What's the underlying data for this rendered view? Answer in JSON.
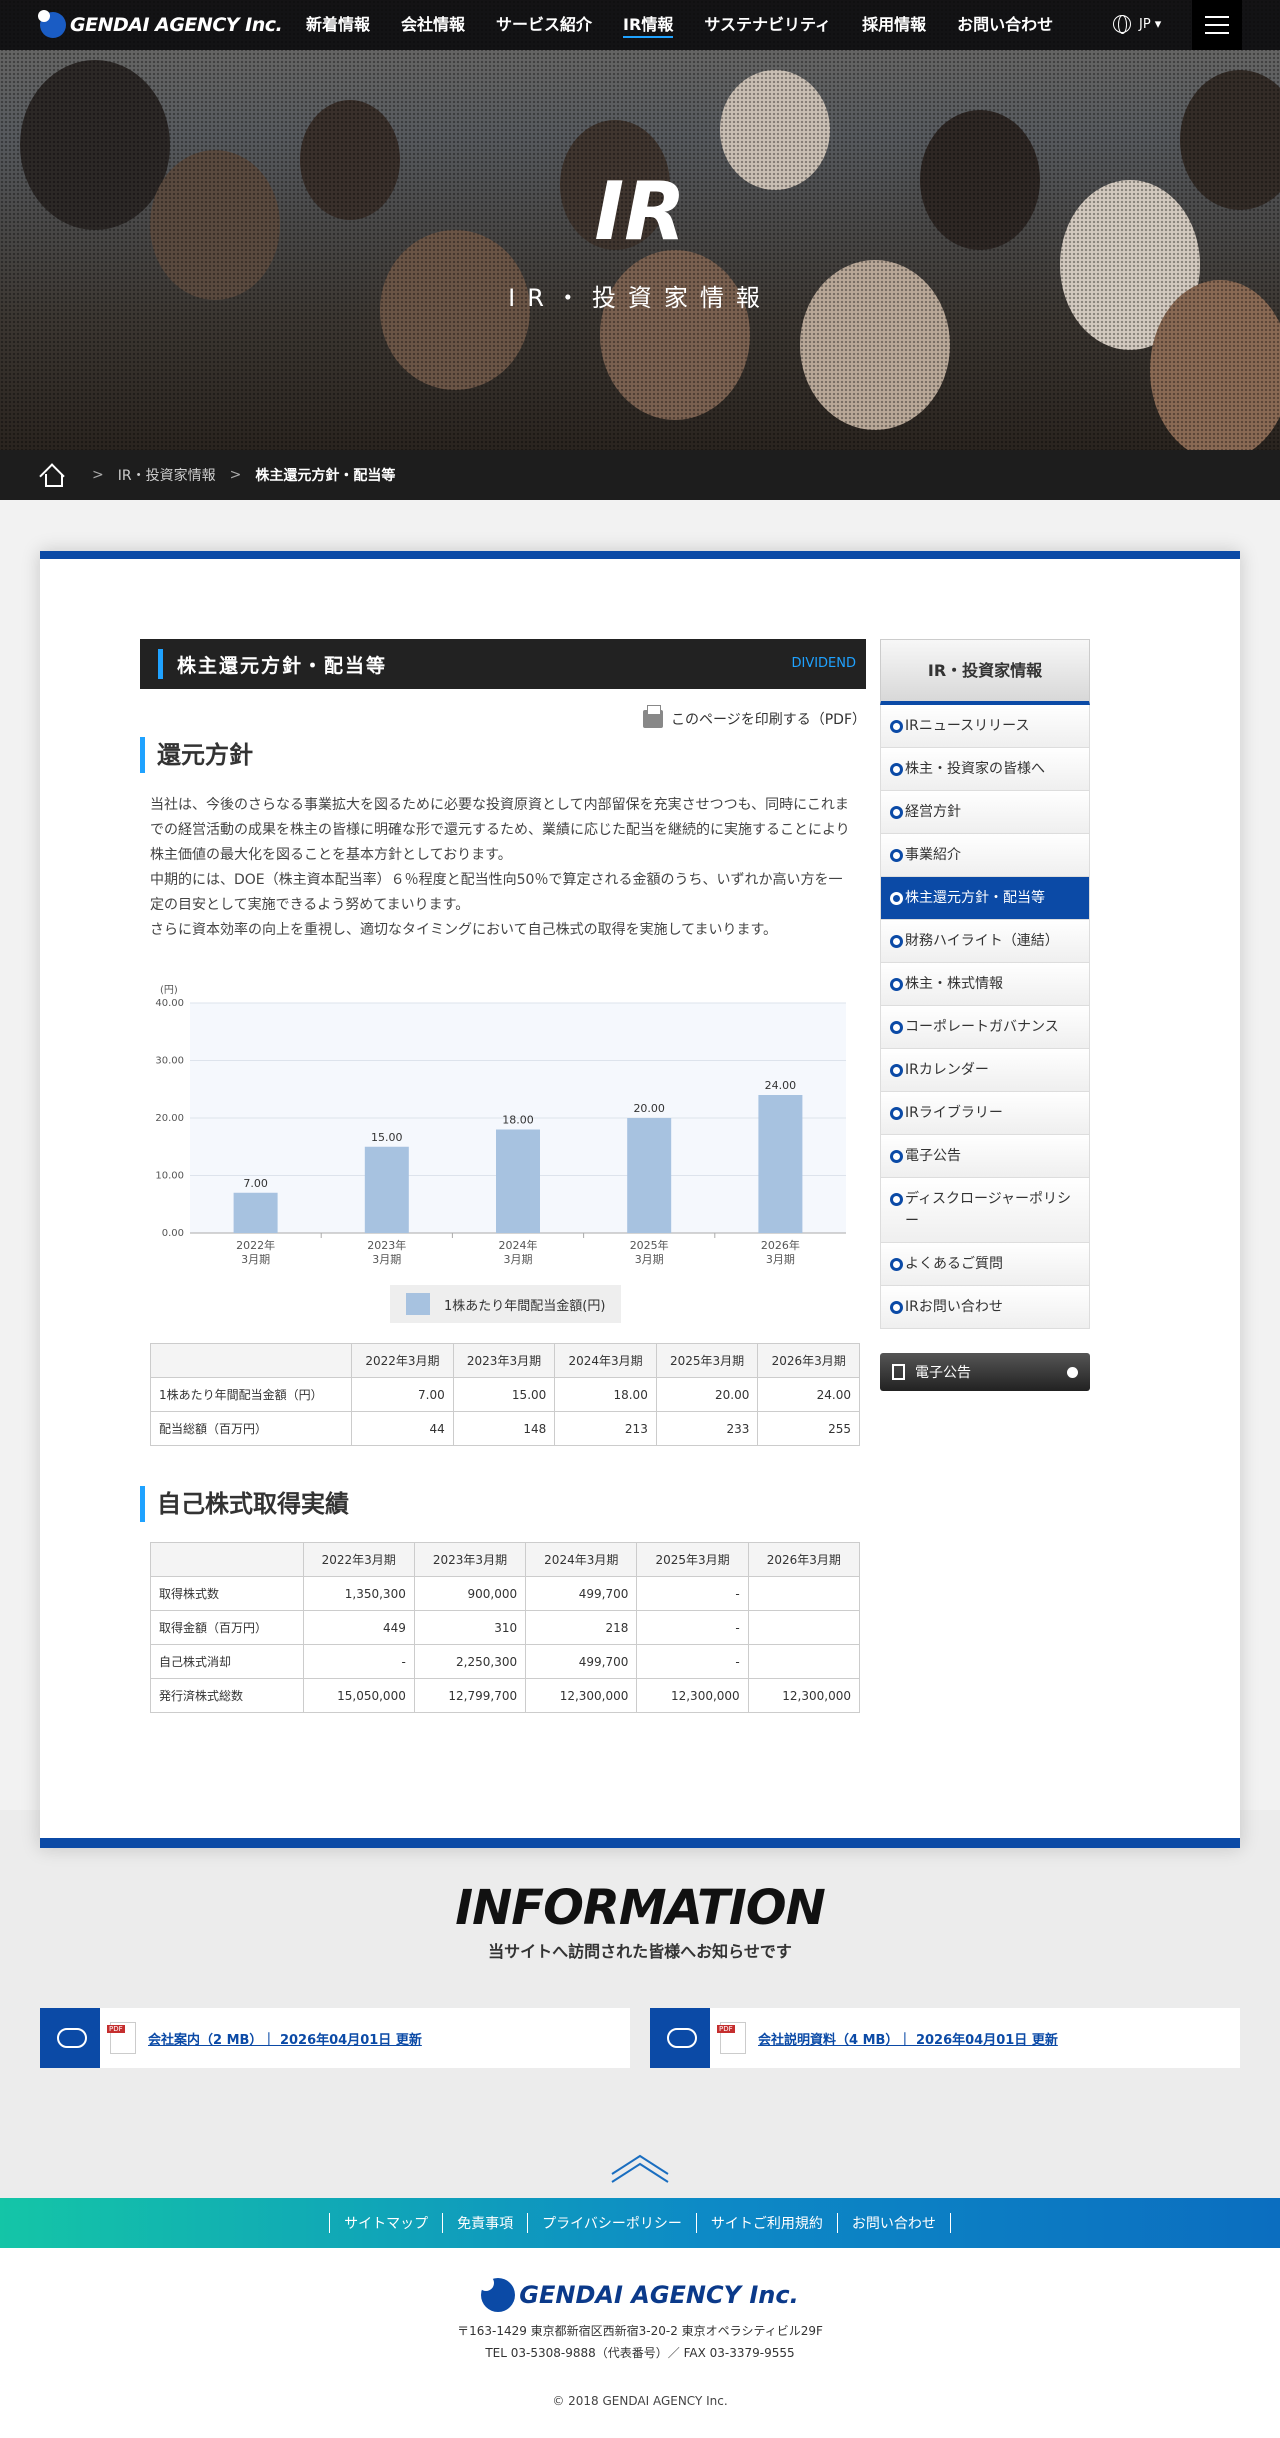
{
  "header": {
    "logo_text": "GENDAI AGENCY Inc.",
    "nav": [
      "新着情報",
      "会社情報",
      "サービス紹介",
      "IR情報",
      "サステナビリティ",
      "採用情報",
      "お問い合わせ"
    ],
    "active_nav": "IR情報",
    "lang": "JP ▾"
  },
  "hero": {
    "title": "IR",
    "subtitle": "IR・投資家情報"
  },
  "breadcrumb": {
    "sep1": ">",
    "item1": "IR・投資家情報",
    "sep2": ">",
    "current": "株主還元方針・配当等"
  },
  "section": {
    "title": "株主還元方針・配当等",
    "en": "DIVIDEND",
    "print": "このページを印刷する（PDF）",
    "h2_policy": "還元方針",
    "paragraphs": [
      "当社は、今後のさらなる事業拡大を図るために必要な投資原資として内部留保を充実させつつも、同時にこれまでの経営活動の成果を株主の皆様に明確な形で還元するため、業績に応じた配当を継続的に実施することにより株主価値の最大化を図ることを基本方針としております。",
      "中期的には、DOE（株主資本配当率）６％程度と配当性向50％で算定される金額のうち、いずれか高い方を一定の目安として実施できるよう努めてまいります。",
      "さらに資本効率の向上を重視し、適切なタイミングにおいて自己株式の取得を実施してまいります。"
    ],
    "h2_buyback": "自己株式取得実績"
  },
  "chart_data": {
    "type": "bar",
    "categories": [
      "2022年\n3月期",
      "2023年\n3月期",
      "2024年\n3月期",
      "2025年\n3月期",
      "2026年\n3月期"
    ],
    "values": [
      7.0,
      15.0,
      18.0,
      20.0,
      24.0
    ],
    "value_labels": [
      "7.00",
      "15.00",
      "18.00",
      "20.00",
      "24.00"
    ],
    "ylabel": "(円)",
    "ylim": [
      0,
      40
    ],
    "yticks": [
      "0.00",
      "10.00",
      "20.00",
      "30.00",
      "40.00"
    ],
    "legend": "1株あたり年間配当金額(円)",
    "color": "#a7c2e0",
    "grid": true
  },
  "dividend_table": {
    "headers": [
      "",
      "2022年3月期",
      "2023年3月期",
      "2024年3月期",
      "2025年3月期",
      "2026年3月期"
    ],
    "rows": [
      [
        "1株あたり年間配当金額（円）",
        "7.00",
        "15.00",
        "18.00",
        "20.00",
        "24.00"
      ],
      [
        "配当総額（百万円）",
        "44",
        "148",
        "213",
        "233",
        "255"
      ]
    ]
  },
  "buyback_table": {
    "headers": [
      "",
      "2022年3月期",
      "2023年3月期",
      "2024年3月期",
      "2025年3月期",
      "2026年3月期"
    ],
    "rows": [
      [
        "取得株式数",
        "1,350,300",
        "900,000",
        "499,700",
        "-",
        ""
      ],
      [
        "取得金額（百万円）",
        "449",
        "310",
        "218",
        "-",
        ""
      ],
      [
        "自己株式消却",
        "-",
        "2,250,300",
        "499,700",
        "-",
        ""
      ],
      [
        "発行済株式総数",
        "15,050,000",
        "12,799,700",
        "12,300,000",
        "12,300,000",
        "12,300,000"
      ]
    ]
  },
  "sidebar": {
    "title": "IR・投資家情報",
    "items": [
      "IRニュースリリース",
      "株主・投資家の皆様へ",
      "経営方針",
      "事業紹介",
      "株主還元方針・配当等",
      "財務ハイライト（連結）",
      "株主・株式情報",
      "コーポレートガバナンス",
      "IRカレンダー",
      "IRライブラリー",
      "電子公告",
      "ディスクロージャーポリシー",
      "よくあるご質問",
      "IRお問い合わせ"
    ],
    "active_index": 4,
    "button": "電子公告"
  },
  "information": {
    "title": "INFORMATION",
    "subtitle": "当サイトへ訪問された皆様へお知らせです",
    "downloads": [
      "会社案内（2 MB）｜ 2026年04月01日 更新",
      "会社説明資料（4 MB）｜ 2026年04月01日 更新"
    ]
  },
  "footer": {
    "links": [
      "サイトマップ",
      "免責事項",
      "プライバシーポリシー",
      "サイトご利用規約",
      "お問い合わせ"
    ],
    "logo_text": "GENDAI AGENCY Inc.",
    "address": "〒163-1429 東京都新宿区西新宿3-20-2 東京オペラシティビル29F",
    "tel": "TEL 03-5308-9888（代表番号）／ FAX 03-3379-9555",
    "copyright": "© 2018 GENDAI AGENCY Inc."
  }
}
